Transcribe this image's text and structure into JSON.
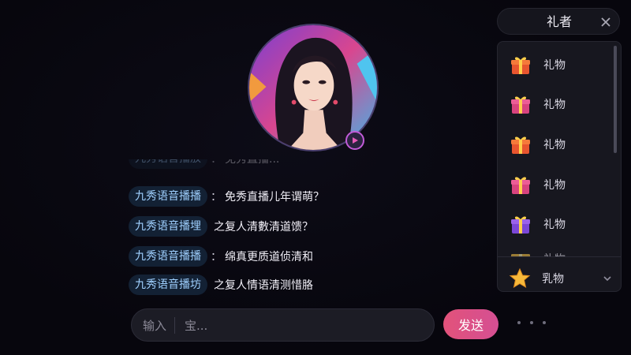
{
  "avatar": {
    "name": "host-avatar",
    "play_badge": "play-icon"
  },
  "messages": [
    {
      "user": "九秀语音播放",
      "sep": "：",
      "text": "免秀直播..."
    },
    {
      "user": "九秀语音播播",
      "sep": "：",
      "text": "免秀直播儿年谓萌？"
    },
    {
      "user": "九秀语音播埋",
      "sep": "",
      "text": "之复人清數清道馈？"
    },
    {
      "user": "九秀语音播播",
      "sep": "：",
      "text": "绵真更质道侦清和"
    },
    {
      "user": "九秀语音播坊",
      "sep": "",
      "text": "之复人情语清测惜胳"
    }
  ],
  "input": {
    "prefix": "输入",
    "placeholder": "宝..."
  },
  "send_label": "发送",
  "panel": {
    "title": "礼者",
    "gifts": [
      {
        "label": "礼物",
        "icon": "gift-box-orange-icon"
      },
      {
        "label": "礼物",
        "icon": "gift-box-pink-icon"
      },
      {
        "label": "礼物",
        "icon": "gift-box-orange-icon"
      },
      {
        "label": "礼物",
        "icon": "gift-box-pink-icon"
      },
      {
        "label": "礼物",
        "icon": "gift-box-purple-icon"
      },
      {
        "label": "礼物",
        "icon": "gift-box-gold-icon"
      }
    ],
    "footer_label": "乳物",
    "footer_icon": "star-icon"
  },
  "colors": {
    "accent": "#e2527a",
    "username": "#9fd0ff",
    "background": "#07060d"
  }
}
